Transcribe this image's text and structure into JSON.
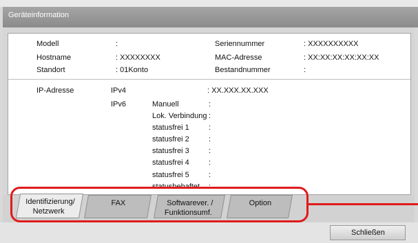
{
  "window": {
    "title": "Geräteinformation"
  },
  "device": {
    "model_label": "Modell",
    "model_value": ":",
    "serial_label": "Seriennummer",
    "serial_value": ":   XXXXXXXXXX",
    "hostname_label": "Hostname",
    "hostname_value": ":   XXXXXXXX",
    "mac_label": "MAC-Adresse",
    "mac_value": ":   XX:XX:XX:XX:XX:XX",
    "location_label": "Standort",
    "location_value": ":   01Konto",
    "asset_label": "Bestandnummer",
    "asset_value": ":"
  },
  "network": {
    "ip_label": "IP-Adresse",
    "ipv4_label": "IPv4",
    "ipv4_value": ":   XX.XXX.XX.XXX",
    "ipv6_label": "IPv6",
    "ipv6_rows": [
      {
        "label": "Manuell",
        "colon": ":"
      },
      {
        "label": "Lok. Verbindung",
        "colon": ":"
      },
      {
        "label": "statusfrei 1",
        "colon": ":"
      },
      {
        "label": "statusfrei 2",
        "colon": ":"
      },
      {
        "label": "statusfrei 3",
        "colon": ":"
      },
      {
        "label": "statusfrei 4",
        "colon": ":"
      },
      {
        "label": "statusfrei 5",
        "colon": ":"
      },
      {
        "label": "statusbehaftet",
        "colon": ":"
      }
    ]
  },
  "tabs": [
    {
      "line1": "Identifizierung/",
      "line2": "Netzwerk",
      "active": true
    },
    {
      "line1": "FAX",
      "line2": "",
      "active": false
    },
    {
      "line1": "Softwarever. /",
      "line2": "Funktionsumf.",
      "active": false
    },
    {
      "line1": "Option",
      "line2": "",
      "active": false
    }
  ],
  "footer": {
    "close_label": "Schließen"
  },
  "colors": {
    "callout": "#e01a1a",
    "titlebar": "#999999"
  }
}
